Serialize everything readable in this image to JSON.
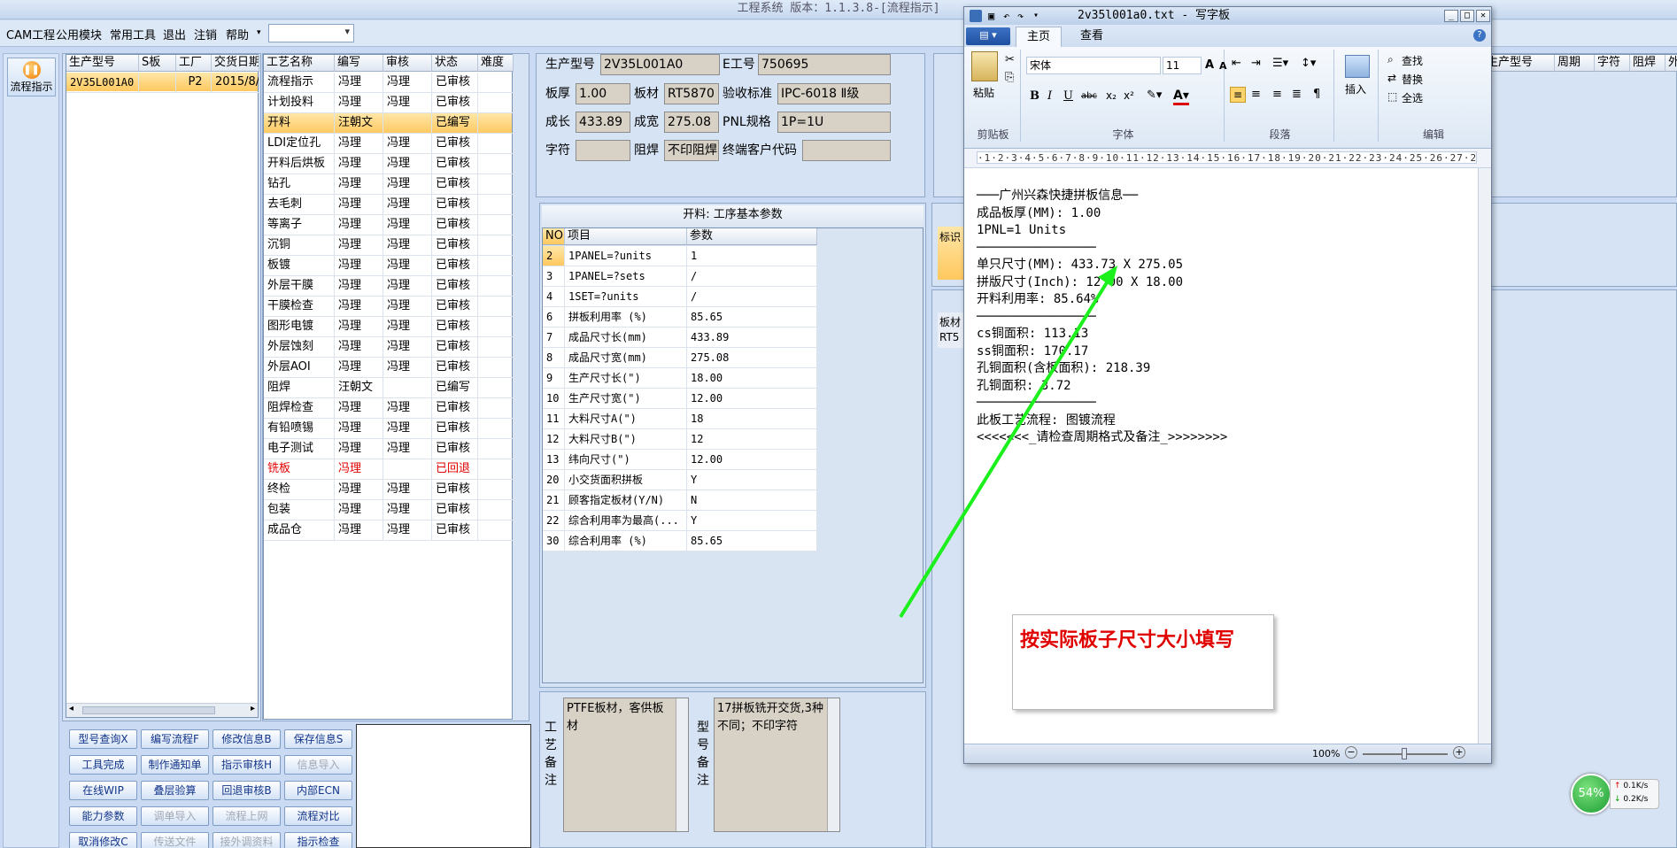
{
  "window": {
    "title": "工程系统 版本：1.1.3.8-[流程指示]"
  },
  "menubar": [
    "CAM工程",
    "公用模块",
    "常用工具",
    "退出",
    "注销",
    "帮助"
  ],
  "sidebar": {
    "flow_button": "流程指示"
  },
  "model_grid": {
    "columns": [
      "生产型号",
      "S板",
      "工厂",
      "交货日期"
    ],
    "rows": [
      [
        "2V35L001A0",
        "",
        "P2",
        "2015/8/8"
      ]
    ]
  },
  "process_grid": {
    "columns": [
      "工艺名称",
      "编写",
      "审核",
      "状态",
      "难度"
    ],
    "rows": [
      [
        "流程指示",
        "冯理",
        "冯理",
        "已审核",
        ""
      ],
      [
        "计划投料",
        "冯理",
        "冯理",
        "已审核",
        ""
      ],
      [
        "开料",
        "汪朝文",
        "",
        "已编写",
        ""
      ],
      [
        "LDI定位孔",
        "冯理",
        "冯理",
        "已审核",
        ""
      ],
      [
        "开料后烘板",
        "冯理",
        "冯理",
        "已审核",
        ""
      ],
      [
        "钻孔",
        "冯理",
        "冯理",
        "已审核",
        ""
      ],
      [
        "去毛刺",
        "冯理",
        "冯理",
        "已审核",
        ""
      ],
      [
        "等离子",
        "冯理",
        "冯理",
        "已审核",
        ""
      ],
      [
        "沉铜",
        "冯理",
        "冯理",
        "已审核",
        ""
      ],
      [
        "板镀",
        "冯理",
        "冯理",
        "已审核",
        ""
      ],
      [
        "外层干膜",
        "冯理",
        "冯理",
        "已审核",
        ""
      ],
      [
        "干膜检查",
        "冯理",
        "冯理",
        "已审核",
        ""
      ],
      [
        "图形电镀",
        "冯理",
        "冯理",
        "已审核",
        ""
      ],
      [
        "外层蚀刻",
        "冯理",
        "冯理",
        "已审核",
        ""
      ],
      [
        "外层AOI",
        "冯理",
        "冯理",
        "已审核",
        ""
      ],
      [
        "阻焊",
        "汪朝文",
        "",
        "已编写",
        ""
      ],
      [
        "阻焊检查",
        "冯理",
        "冯理",
        "已审核",
        ""
      ],
      [
        "有铅喷锡",
        "冯理",
        "冯理",
        "已审核",
        ""
      ],
      [
        "电子测试",
        "冯理",
        "冯理",
        "已审核",
        ""
      ],
      [
        "铣板",
        "冯理",
        "",
        "已回退",
        ""
      ],
      [
        "终检",
        "冯理",
        "冯理",
        "已审核",
        ""
      ],
      [
        "包装",
        "冯理",
        "冯理",
        "已审核",
        ""
      ],
      [
        "成品仓",
        "冯理",
        "冯理",
        "已审核",
        ""
      ]
    ]
  },
  "info": {
    "model_label": "生产型号",
    "model": "2V35L001A0",
    "eno_label": "E工号",
    "eno": "750695",
    "thick_label": "板厚",
    "thick": "1.00",
    "mat_label": "板材",
    "mat": "RT5870",
    "std_label": "验收标准",
    "std": "IPC-6018 Ⅱ级",
    "len_label": "成长",
    "len": "433.89",
    "wid_label": "成宽",
    "wid": "275.08",
    "pnl_label": "PNL规格",
    "pnl": "1P=1U",
    "char_label": "字符",
    "char": "",
    "mask_label": "阻焊",
    "mask": "不印阻焊",
    "cust_label": "终端客户代码",
    "cust": ""
  },
  "param_grid": {
    "title": "开料: 工序基本参数",
    "columns": [
      "NO",
      "项目",
      "参数"
    ],
    "rows": [
      [
        "2",
        "1PANEL=?units",
        "1"
      ],
      [
        "3",
        "1PANEL=?sets",
        "/"
      ],
      [
        "4",
        "1SET=?units",
        "/"
      ],
      [
        "6",
        "拼板利用率 (%)",
        "85.65"
      ],
      [
        "7",
        "成品尺寸长(mm)",
        "433.89"
      ],
      [
        "8",
        "成品尺寸宽(mm)",
        "275.08"
      ],
      [
        "9",
        "生产尺寸长(\")",
        "18.00"
      ],
      [
        "10",
        "生产尺寸宽(\")",
        "12.00"
      ],
      [
        "11",
        "大料尺寸A(\")",
        "18"
      ],
      [
        "12",
        "大料尺寸B(\")",
        "12"
      ],
      [
        "13",
        "纬向尺寸(\")",
        "12.00"
      ],
      [
        "20",
        "小交货面积拼板",
        "Y"
      ],
      [
        "21",
        "顾客指定板材(Y/N)",
        "N"
      ],
      [
        "22",
        "综合利用率为最高(...",
        "Y"
      ],
      [
        "30",
        "综合利用率 (%)",
        "85.65"
      ]
    ]
  },
  "remarks": {
    "process_label": "工艺备注",
    "process_text": "PTFE板材，客供板材",
    "model_label": "型号备注",
    "model_text": "17拼板铣开交货,3种不同；不印字符"
  },
  "buttons": [
    [
      "型号查询X",
      "编写流程F",
      "修改信息B",
      "保存信息S"
    ],
    [
      "工具完成",
      "制作通知单",
      "指示审核H",
      "信息导入"
    ],
    [
      "在线WIP",
      "叠层验算",
      "回退审核B",
      "内部ECN"
    ],
    [
      "能力参数",
      "调单导入",
      "流程上网",
      "流程对比"
    ],
    [
      "取消修改C",
      "传送文件",
      "接外调资料",
      "指示检查"
    ]
  ],
  "right_partial": {
    "headers": [
      "生产型号",
      "周期",
      "字符",
      "阻焊",
      "外"
    ],
    "tag1": "标识",
    "tag2": "板材",
    "tag3": "RT5"
  },
  "wordpad": {
    "title": "2v35l001a0.txt - 写字板",
    "tabs": [
      "主页",
      "查看"
    ],
    "font_name": "宋体",
    "font_size": "11",
    "groups": [
      "剪贴板",
      "字体",
      "段落",
      "编辑"
    ],
    "paste": "粘贴",
    "insert": "插入",
    "edit_items": [
      "查找",
      "替换",
      "全选"
    ],
    "lines": [
      "───广州兴森快捷拼板信息──",
      "成品板厚(MM): 1.00",
      "1PNL=1 Units",
      "────────────────",
      "单只尺寸(MM): 433.73 X 275.05",
      "拼版尺寸(Inch): 12.00 X 18.00",
      "开料利用率: 85.64%",
      "────────────────",
      "cs铜面积: 113.13",
      "ss铜面积: 170.17",
      "孔铜面积(含板面积): 218.39",
      "孔铜面积: 3.72",
      "────────────────",
      "此板工艺流程: 图镀流程",
      "<<<<<<<_请检查周期格式及备注_>>>>>>>>"
    ],
    "zoom": "100%"
  },
  "note": "按实际板子尺寸大小填写",
  "net_widget": {
    "percent": "54%",
    "up": "0.1K/s",
    "down": "0.2K/s"
  }
}
